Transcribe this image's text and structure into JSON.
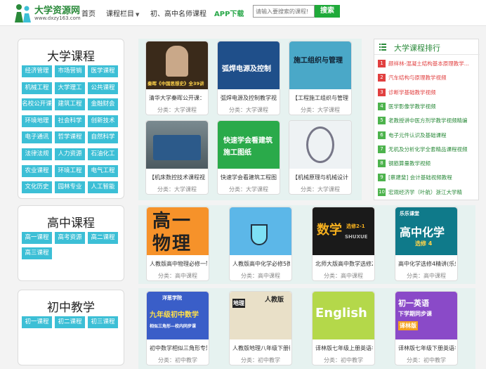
{
  "header": {
    "logo_title": "大学资源网",
    "logo_sub": "www.dxzy163.com",
    "nav": [
      "首页",
      "课程栏目",
      "初、高中名师课程",
      "APP下载"
    ],
    "search_placeholder": "请输入要搜索的课程!",
    "search_button": "搜索"
  },
  "university": {
    "title": "大学课程",
    "tags": [
      "经济管理",
      "市场营销",
      "医学课程",
      "机械工程",
      "大学理工",
      "公共课程",
      "名校公开课",
      "建筑工程",
      "金融财会",
      "环境地理",
      "社会科学",
      "创新技术",
      "电子通讯",
      "哲学课程",
      "自然科学",
      "法律法规",
      "人力资源",
      "石油化工",
      "农业课程",
      "环境工程",
      "电气工程",
      "文化历史",
      "园林专业",
      "人工智能"
    ],
    "cards": [
      {
        "title": "清华大学秦晖公开课：",
        "category": "分类：大学课程",
        "img_text": "秦晖《中国思想史》全39讲"
      },
      {
        "title": "弧焊电源及控制教学视",
        "category": "分类：大学课程",
        "img_text": "弧焊电源及控制"
      },
      {
        "title": "【工程施工组织与管理",
        "category": "分类：大学课程",
        "img_text": "施工组织与管理"
      },
      {
        "title": "【机床数控技术课程视",
        "category": "分类：大学课程",
        "img_text": ""
      },
      {
        "title": "快速学会看建筑工程图",
        "category": "分类：大学课程",
        "img_text": "快速学会看建筑施工图纸"
      },
      {
        "title": "【机械原理与机械设计",
        "category": "分类：大学课程",
        "img_text": ""
      }
    ]
  },
  "highschool": {
    "title": "高中课程",
    "tags": [
      "高一课程",
      "高考资源",
      "高二课程",
      "高三课程"
    ],
    "cards": [
      {
        "title": "人教版高中物理必修一辅导",
        "category": "分类：高中课程",
        "img_text": "高一物理"
      },
      {
        "title": "人教版高中化学必修5微课视",
        "category": "分类：高中课程",
        "img_text": ""
      },
      {
        "title": "北师大版高中数学选修2-1云",
        "category": "分类：高中课程",
        "img_text": "数学",
        "img_sub": "选修2-1",
        "img_sub2": "SHUXUE"
      },
      {
        "title": "高中化学选修4精讲(乐乐课",
        "category": "分类：高中课程",
        "img_text": "高中化学",
        "img_sub": "选修 4",
        "img_top": "乐乐课堂"
      }
    ]
  },
  "junior": {
    "title": "初中教学",
    "tags": [
      "初一课程",
      "初二课程",
      "初三课程"
    ],
    "cards": [
      {
        "title": "初中数学相似三角形专题课",
        "category": "分类：初中教学",
        "img_text": "九年级初中数学",
        "img_sub": "相似三角形—校内同步课",
        "img_top": "洋葱学院"
      },
      {
        "title": "人教版地理八年级下册微课",
        "category": "分类：初中教学",
        "img_text": "地理",
        "img_sub": "人教版"
      },
      {
        "title": "译林版七年级上册英语名师",
        "category": "分类：初中教学",
        "img_text": "English"
      },
      {
        "title": "译林版七年级下册英语名师",
        "category": "分类：初中教学",
        "img_text": "初一英语",
        "img_sub": "下学期同步课",
        "img_top": "译林版"
      }
    ]
  },
  "ranking": {
    "title": "大学课程排行",
    "items": [
      {
        "num": "1",
        "text": "颜祥林-混凝土结构基本原理教学..."
      },
      {
        "num": "2",
        "text": "汽车结构与原理教学视频"
      },
      {
        "num": "3",
        "text": "诊断学基础教学视频"
      },
      {
        "num": "4",
        "text": "医学影像学教学视频"
      },
      {
        "num": "5",
        "text": "老教授讲中医方剂学教学视频精编"
      },
      {
        "num": "6",
        "text": "电子元件认识及基础课程"
      },
      {
        "num": "7",
        "text": "无机及分析化学全套精品课程视频"
      },
      {
        "num": "8",
        "text": "钢筋算量教学视频"
      },
      {
        "num": "9",
        "text": "[蔡建斐] 会计基础视频教程"
      },
      {
        "num": "10",
        "text": "宏观经济学（叶航）浙江大学精"
      }
    ]
  },
  "colors": {
    "brand_green": "#1faa3a",
    "tag_blue": "#3cbfd6",
    "rank_red": "#e14040",
    "rank_green": "#4db34d"
  }
}
